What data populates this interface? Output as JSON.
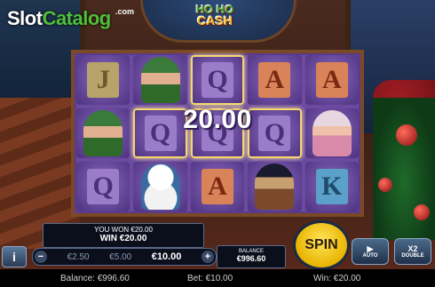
{
  "watermark": {
    "brand_a": "Slot",
    "brand_b": "Catalog",
    "suffix": ".com"
  },
  "game": {
    "logo_top": "HO HO",
    "logo_bottom": "CASH"
  },
  "reels": [
    [
      "J",
      "elf",
      "Q"
    ],
    [
      "elf-2",
      "Q",
      "snowman"
    ],
    [
      "Q",
      "Q",
      "A"
    ],
    [
      "A",
      "Q",
      "radio"
    ],
    [
      "A",
      "lady",
      "K"
    ]
  ],
  "win_overlay": "20.00",
  "win_panel": {
    "line1": "YOU WON €20.00",
    "line2": "WIN €20.00"
  },
  "bet_options": [
    "€2.50",
    "€5.00",
    "€10.00"
  ],
  "bet_selected": "€10.00",
  "balance_panel": {
    "label": "BALANCE",
    "value": "€996.60"
  },
  "buttons": {
    "info": "i",
    "spin": "SPIN",
    "auto": "AUTO",
    "double_top": "X2",
    "double": "DOUBLE",
    "minus": "−",
    "plus": "+"
  },
  "status": {
    "balance": "Balance: €996.60",
    "bet": "Bet: €10.00",
    "win": "Win: €20.00"
  },
  "colors": {
    "spin": "#ffd21f",
    "accent_green": "#4fbf3a",
    "reel_bg": "#6b4aa0"
  }
}
